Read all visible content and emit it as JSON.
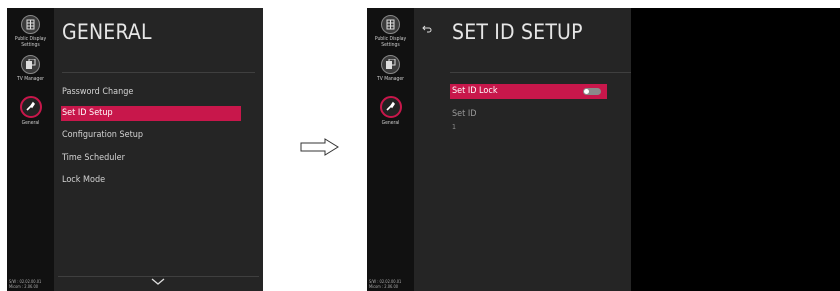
{
  "sidebar": {
    "items": [
      {
        "label": "Public Display Settings",
        "icon": "public-display-icon"
      },
      {
        "label": "TV Manager",
        "icon": "tv-manager-icon"
      },
      {
        "label": "General",
        "icon": "general-wrench-icon"
      }
    ],
    "footer": {
      "sw": "S/W : 02.02.00.01",
      "micom": "Micom : 2.06.00"
    }
  },
  "left": {
    "title": "GENERAL",
    "menu": [
      "Password Change",
      "Set ID Setup",
      "Configuration Setup",
      "Time Scheduler",
      "Lock Mode"
    ],
    "selected_index": 1
  },
  "right": {
    "title": "SET ID SETUP",
    "set_id_lock_label": "Set ID Lock",
    "set_id_lock_on": false,
    "set_id_label": "Set ID",
    "set_id_value": "1"
  },
  "colors": {
    "accent": "#c8174b",
    "panel": "#252525",
    "sidebar": "#111111"
  }
}
